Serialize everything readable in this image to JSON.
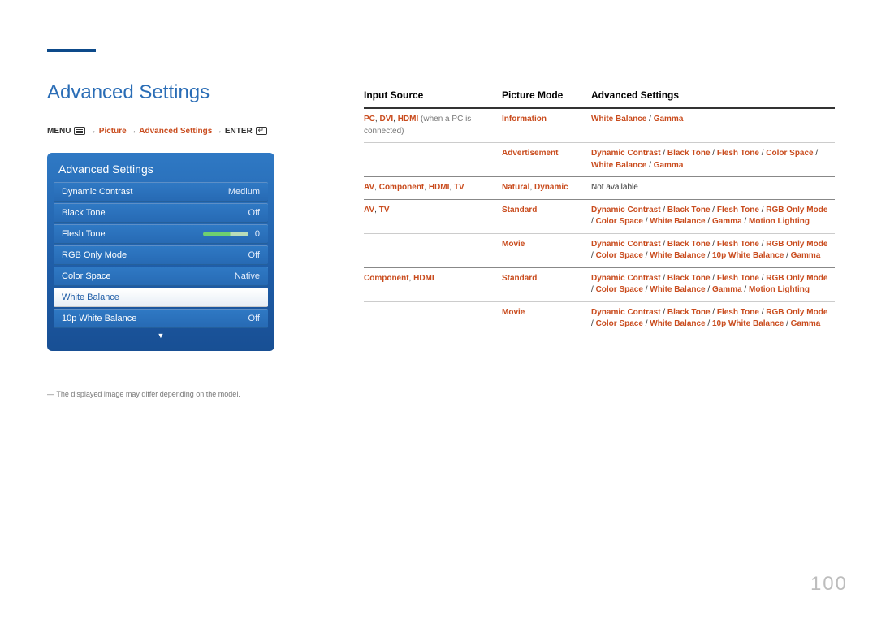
{
  "title": "Advanced Settings",
  "breadcrumb": {
    "menu": "MENU",
    "arrow": "→",
    "picture": "Picture",
    "advanced": "Advanced Settings",
    "enter": "ENTER"
  },
  "osd": {
    "title": "Advanced Settings",
    "rows": [
      {
        "label": "Dynamic Contrast",
        "value": "Medium"
      },
      {
        "label": "Black Tone",
        "value": "Off"
      },
      {
        "label": "Flesh Tone",
        "value": "0",
        "slider": true
      },
      {
        "label": "RGB Only Mode",
        "value": "Off"
      },
      {
        "label": "Color Space",
        "value": "Native"
      },
      {
        "label": "White Balance",
        "value": "",
        "white": true
      },
      {
        "label": "10p White Balance",
        "value": "Off"
      }
    ],
    "arrow": "▼"
  },
  "footnote": "― The displayed image may differ depending on the model.",
  "table": {
    "headers": [
      "Input Source",
      "Picture Mode",
      "Advanced Settings"
    ],
    "groups": [
      {
        "input_html": "<span class='red'>PC</span>, <span class='red'>DVI</span>, <span class='red'>HDMI</span> <span class='grey'>(when a PC is connected)</span>",
        "rows": [
          {
            "mode": "Information",
            "settings": "<span class='red'>White Balance</span> / <span class='red'>Gamma</span>"
          },
          {
            "mode": "Advertisement",
            "settings": "<span class='red'>Dynamic Contrast</span> / <span class='red'>Black Tone</span> / <span class='red'>Flesh Tone</span> / <span class='red'>Color Space</span> / <span class='red'>White Balance</span> / <span class='red'>Gamma</span>"
          }
        ]
      },
      {
        "input_html": "<span class='red'>AV</span>, <span class='red'>Component</span>, <span class='red'>HDMI</span>, <span class='red'>TV</span>",
        "rows": [
          {
            "mode_html": "<span class='red'>Natural</span>, <span class='red'>Dynamic</span>",
            "settings_plain": "Not available"
          }
        ]
      },
      {
        "input_html": "<span class='red'>AV</span>, <span class='red'>TV</span>",
        "rows": [
          {
            "mode": "Standard",
            "settings": "<span class='red'>Dynamic Contrast</span> / <span class='red'>Black Tone</span> / <span class='red'>Flesh Tone</span> / <span class='red'>RGB Only Mode</span> / <span class='red'>Color Space</span> / <span class='red'>White Balance</span> / <span class='red'>Gamma</span> / <span class='red'>Motion Lighting</span>"
          },
          {
            "mode": "Movie",
            "settings": "<span class='red'>Dynamic Contrast</span> / <span class='red'>Black Tone</span> / <span class='red'>Flesh Tone</span> / <span class='red'>RGB Only Mode</span> / <span class='red'>Color Space</span> / <span class='red'>White Balance</span> / <span class='red'>10p White Balance</span> / <span class='red'>Gamma</span>"
          }
        ]
      },
      {
        "input_html": "<span class='red'>Component</span>, <span class='red'>HDMI</span>",
        "rows": [
          {
            "mode": "Standard",
            "settings": "<span class='red'>Dynamic Contrast</span> / <span class='red'>Black Tone</span> / <span class='red'>Flesh Tone</span> / <span class='red'>RGB Only Mode</span> / <span class='red'>Color Space</span> / <span class='red'>White Balance</span> / <span class='red'>Gamma</span> / <span class='red'>Motion Lighting</span>"
          },
          {
            "mode": "Movie",
            "settings": "<span class='red'>Dynamic Contrast</span> / <span class='red'>Black Tone</span> / <span class='red'>Flesh Tone</span> / <span class='red'>RGB Only Mode</span> / <span class='red'>Color Space</span> / <span class='red'>White Balance</span> / <span class='red'>10p White Balance</span> / <span class='red'>Gamma</span>"
          }
        ]
      }
    ]
  },
  "page_number": "100"
}
